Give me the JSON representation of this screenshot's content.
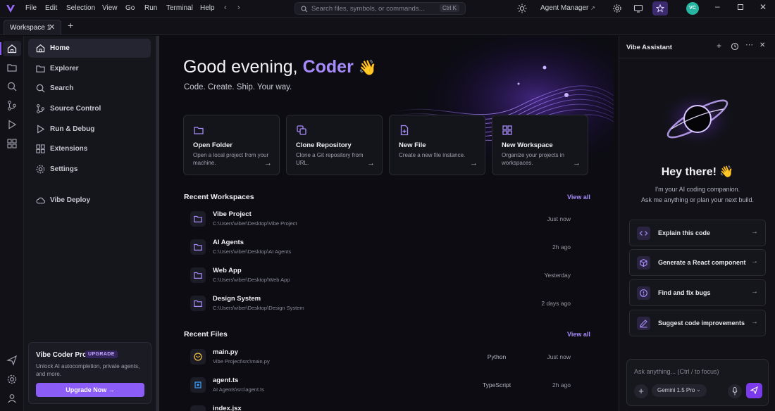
{
  "menu": [
    "File",
    "Edit",
    "Selection",
    "View",
    "Go",
    "Run",
    "Terminal",
    "Help"
  ],
  "search": {
    "placeholder": "Search files, symbols, or commands...",
    "shortcut": "Ctrl K"
  },
  "titlebar": {
    "agent_manager": "Agent Manager",
    "avatar_initials": "VC"
  },
  "tabs": [
    {
      "label": "Workspace 1"
    }
  ],
  "sidebar": {
    "items": [
      {
        "label": "Home",
        "icon": "home-icon"
      },
      {
        "label": "Explorer",
        "icon": "folder-icon"
      },
      {
        "label": "Search",
        "icon": "search-icon"
      },
      {
        "label": "Source Control",
        "icon": "branch-icon"
      },
      {
        "label": "Run & Debug",
        "icon": "play-icon"
      },
      {
        "label": "Extensions",
        "icon": "grid-icon"
      },
      {
        "label": "Settings",
        "icon": "gear-icon"
      },
      {
        "label": "Vibe Deploy",
        "icon": "cloud-icon"
      }
    ],
    "pro": {
      "title": "Vibe Coder Pro",
      "badge": "UPGRADE",
      "description": "Unlock AI autocompletion, private agents, and more.",
      "button": "Upgrade Now →"
    }
  },
  "main": {
    "greeting_prefix": "Good evening, ",
    "greeting_name": "Coder",
    "greeting_emoji": "👋",
    "tagline": "Code. Create. Ship. Your way.",
    "actions": [
      {
        "title": "Open Folder",
        "description": "Open a local project from your machine.",
        "icon": "folder-icon"
      },
      {
        "title": "Clone Repository",
        "description": "Clone a Git repository from URL.",
        "icon": "copy-icon"
      },
      {
        "title": "New File",
        "description": "Create a new file instance.",
        "icon": "file-plus-icon"
      },
      {
        "title": "New Workspace",
        "description": "Organize your projects in workspaces.",
        "icon": "grid-icon"
      }
    ],
    "recent_workspaces_title": "Recent Workspaces",
    "recent_files_title": "Recent Files",
    "view_all": "View all",
    "workspaces": [
      {
        "name": "Vibe Project",
        "path": "C:\\Users\\viber\\Desktop\\Vibe Project",
        "time": "Just now"
      },
      {
        "name": "AI Agents",
        "path": "C:\\Users\\viber\\Desktop\\AI Agents",
        "time": "2h ago"
      },
      {
        "name": "Web App",
        "path": "C:\\Users\\viber\\Desktop\\Web App",
        "time": "Yesterday"
      },
      {
        "name": "Design System",
        "path": "C:\\Users\\viber\\Desktop\\Design System",
        "time": "2 days ago"
      }
    ],
    "files": [
      {
        "name": "main.py",
        "path": "Vibe Project\\src\\main.py",
        "language": "Python",
        "time": "Just now"
      },
      {
        "name": "agent.ts",
        "path": "AI Agents\\src\\agent.ts",
        "language": "TypeScript",
        "time": "2h ago"
      },
      {
        "name": "index.jsx",
        "path": "",
        "language": "",
        "time": ""
      }
    ]
  },
  "assistant": {
    "title": "Vibe Assistant",
    "greeting": "Hey there! 👋",
    "subtitle_line1": "I'm your AI coding companion.",
    "subtitle_line2": "Ask me anything or plan your next build.",
    "suggestions": [
      {
        "label": "Explain this code",
        "icon": "code-icon"
      },
      {
        "label": "Generate a React component",
        "icon": "cube-icon"
      },
      {
        "label": "Find and fix bugs",
        "icon": "alert-icon"
      },
      {
        "label": "Suggest code improvements",
        "icon": "pen-icon"
      }
    ],
    "input_placeholder": "Ask anything... (Ctrl / to focus)",
    "model": "Gemini 1.5 Pro"
  },
  "colors": {
    "accent": "#8b5cf6",
    "accent_light": "#a78bfa",
    "background": "#0c0c12"
  }
}
